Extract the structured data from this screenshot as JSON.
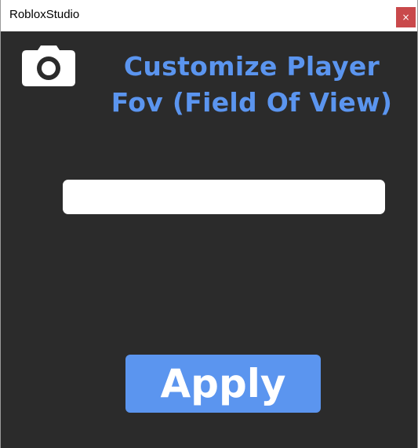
{
  "window": {
    "title": "RobloxStudio",
    "close_label": "×"
  },
  "main": {
    "heading_line1": "Customize Player",
    "heading_line2": "Fov (Field Of View)",
    "fov_input": {
      "value": "",
      "placeholder": ""
    },
    "apply_label": "Apply",
    "icon": "camera-icon"
  },
  "colors": {
    "accent": "#5b95ef",
    "background": "#2b2b2b",
    "close": "#c9494b"
  }
}
